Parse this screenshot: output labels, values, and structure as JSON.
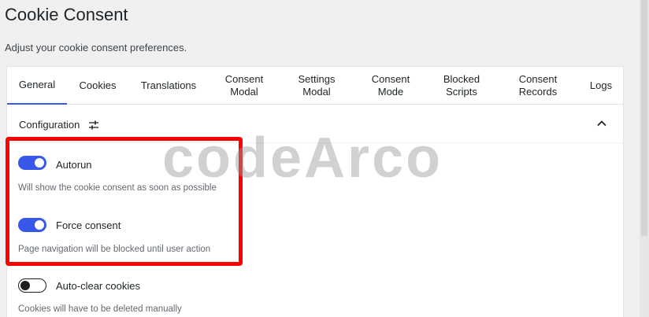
{
  "header": {
    "title": "Cookie Consent",
    "description": "Adjust your cookie consent preferences."
  },
  "tabs": [
    {
      "label": "General",
      "active": true
    },
    {
      "label": "Cookies"
    },
    {
      "label": "Translations"
    },
    {
      "label": "Consent Modal"
    },
    {
      "label": "Settings Modal"
    },
    {
      "label": "Consent Mode"
    },
    {
      "label": "Blocked Scripts"
    },
    {
      "label": "Consent Records"
    },
    {
      "label": "Logs"
    }
  ],
  "section": {
    "title": "Configuration",
    "icon": "settings-sliders-icon",
    "collapse_icon": "chevron-up-icon"
  },
  "options": [
    {
      "label": "Autorun",
      "help": "Will show the cookie consent as soon as possible",
      "enabled": true
    },
    {
      "label": "Force consent",
      "help": "Page navigation will be blocked until user action",
      "enabled": true
    },
    {
      "label": "Auto-clear cookies",
      "help": "Cookies will have to be deleted manually",
      "enabled": false
    }
  ],
  "watermark": "codeArco",
  "colors": {
    "accent": "#3858e9",
    "highlight": "#ff0000"
  }
}
